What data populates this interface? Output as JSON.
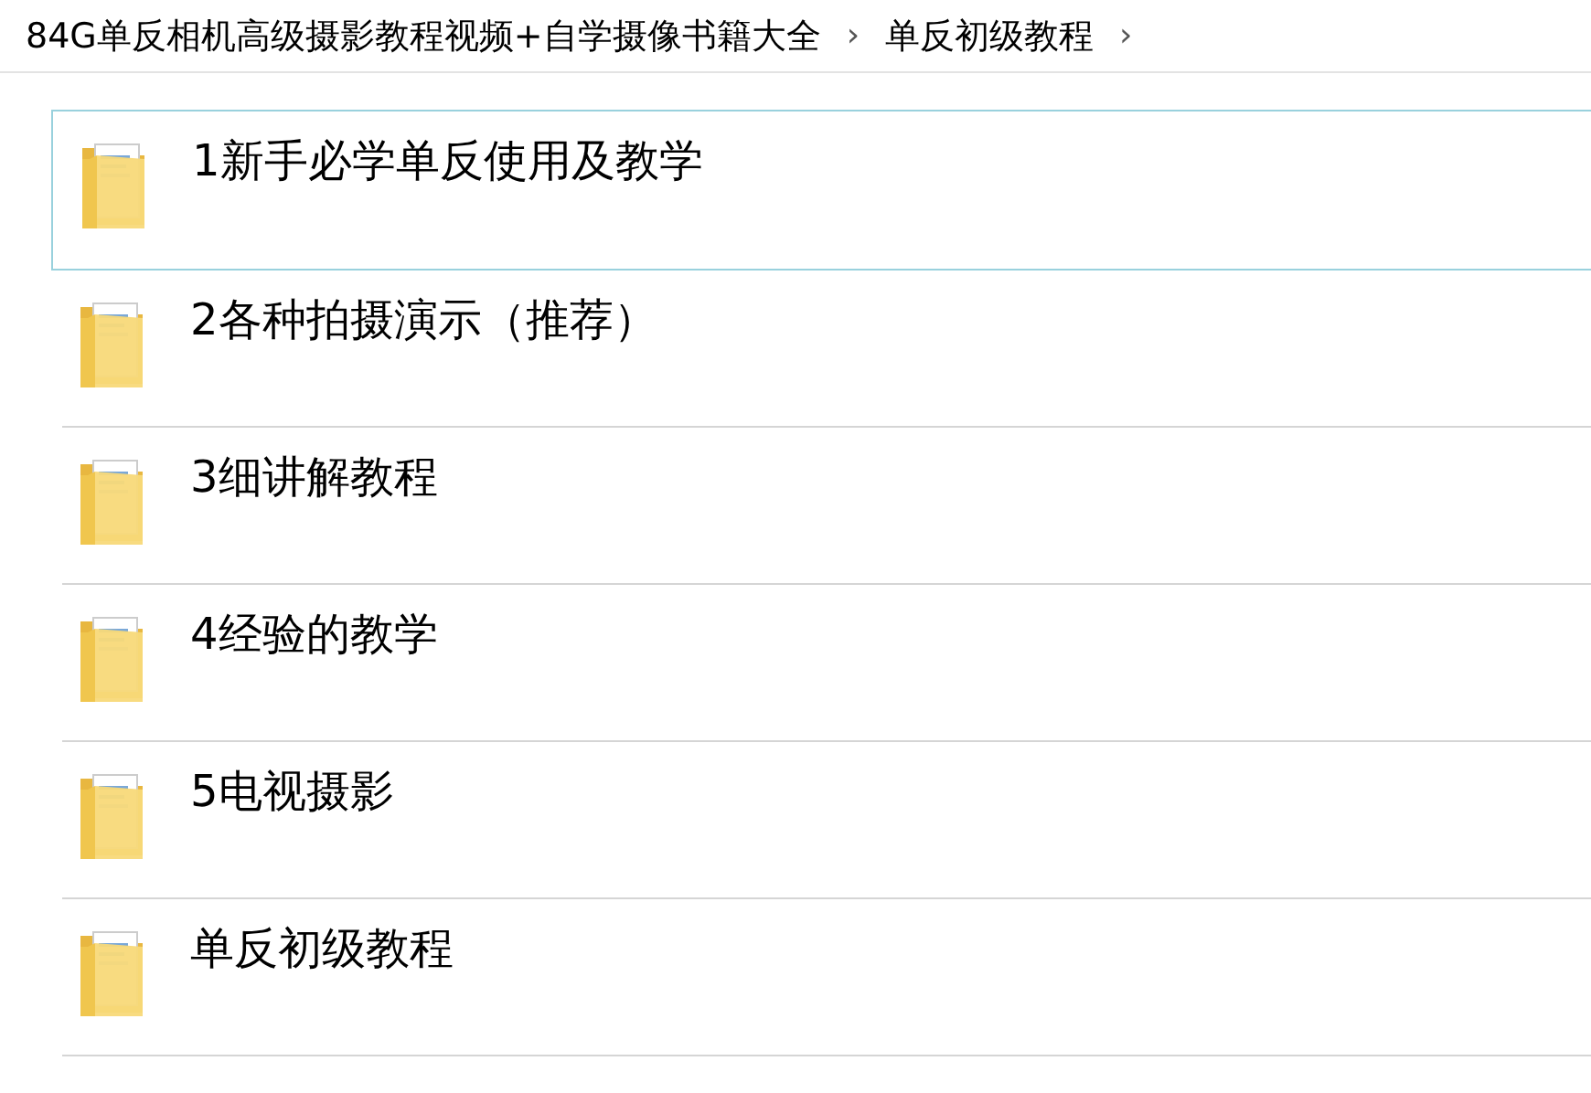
{
  "breadcrumb": [
    {
      "label": "84G单反相机高级摄影教程视频+自学摄像书籍大全",
      "separator": "›"
    },
    {
      "label": "单反初级教程",
      "separator": "›"
    }
  ],
  "items": [
    {
      "name": "1新手必学单反使用及教学",
      "selected": true
    },
    {
      "name": "2各种拍摄演示（推荐）",
      "selected": false
    },
    {
      "name": "3细讲解教程",
      "selected": false
    },
    {
      "name": "4经验的教学",
      "selected": false
    },
    {
      "name": "5电视摄影",
      "selected": false
    },
    {
      "name": "单反初级教程",
      "selected": false
    }
  ]
}
